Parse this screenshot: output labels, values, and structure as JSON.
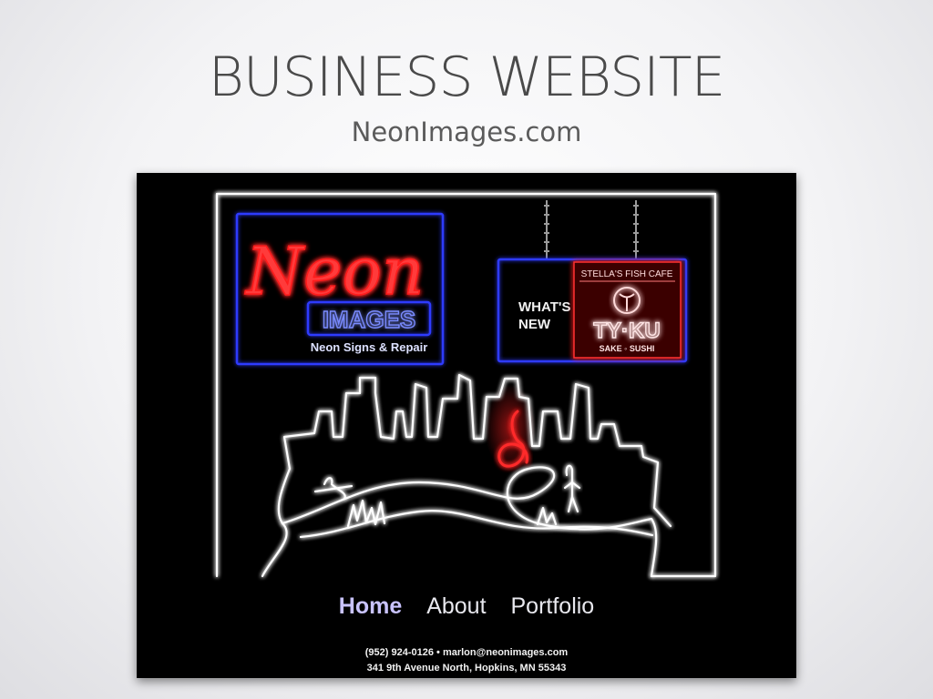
{
  "slide": {
    "title": "BUSINESS WEBSITE",
    "subtitle": "NeonImages.com"
  },
  "logo": {
    "script_text": "Neon",
    "box_text": "IMAGES",
    "tagline": "Neon Signs & Repair"
  },
  "whats_new": {
    "label_line1": "WHAT'S",
    "label_line2": "NEW",
    "sign_top": "STELLA'S FISH CAFE",
    "sign_brand": "TY·KU",
    "sign_bottom": "SAKE ◦ SUSHI"
  },
  "nav": {
    "home": "Home",
    "about": "About",
    "portfolio": "Portfolio"
  },
  "contact": {
    "line1": "(952) 924-0126  •  marlon@neonimages.com",
    "line2": "341 9th Avenue North, Hopkins, MN 55343"
  },
  "colors": {
    "background": "#000000",
    "neon_red": "#ff2a2a",
    "neon_blue": "#2f3bff",
    "neon_white": "#ffffff",
    "nav_active": "#c9c3ff"
  }
}
